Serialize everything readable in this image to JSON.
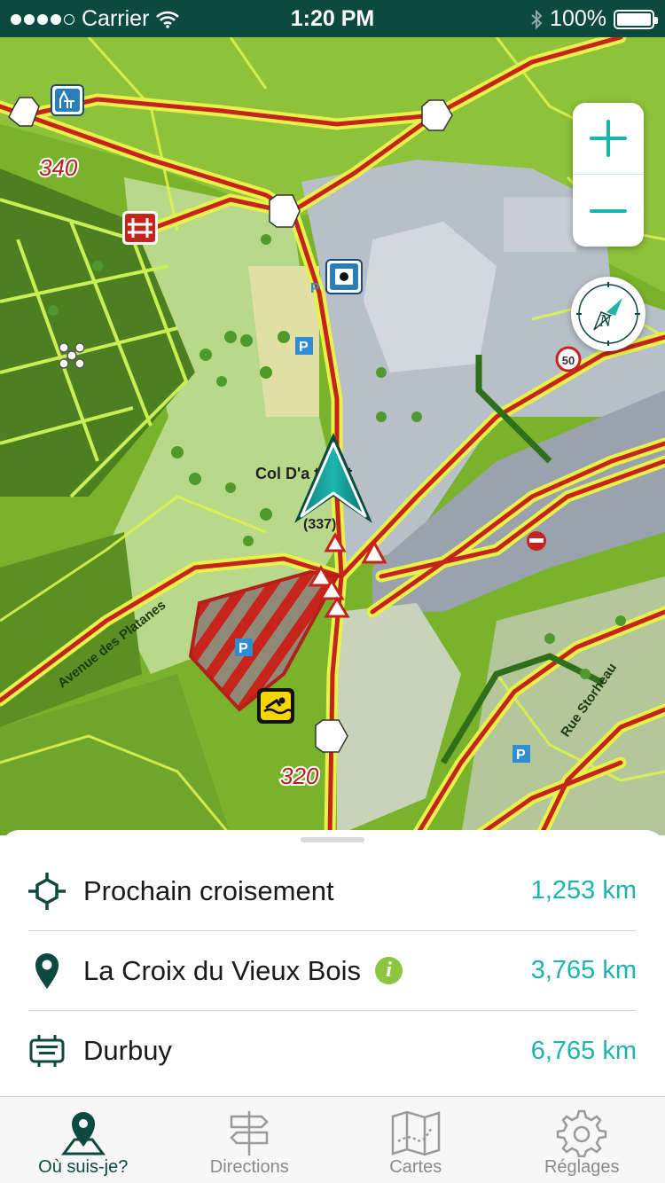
{
  "status_bar": {
    "carrier": "Carrier",
    "time": "1:20 PM",
    "battery": "100%"
  },
  "map": {
    "elevation_labels": [
      "340",
      "320"
    ],
    "place_label": "Col D'a    tte et",
    "place_elevation": "(337)",
    "street_labels": [
      "Avenue des Platanes",
      "Rue Storheau"
    ],
    "speed_limit": "50"
  },
  "nearby": [
    {
      "icon": "crossroads-icon",
      "label": "Prochain croisement",
      "distance": "1,253 km"
    },
    {
      "icon": "location-pin-icon",
      "label": "La Croix du Vieux Bois",
      "distance": "3,765 km"
    },
    {
      "icon": "signpost-board-icon",
      "label": "Durbuy",
      "distance": "6,765 km"
    }
  ],
  "info_glyph": "i",
  "tabs": [
    {
      "label": "Où suis-je?",
      "icon": "map-pin-tab-icon",
      "active": true
    },
    {
      "label": "Directions",
      "icon": "signpost-tab-icon",
      "active": false
    },
    {
      "label": "Cartes",
      "icon": "folded-map-tab-icon",
      "active": false
    },
    {
      "label": "Réglages",
      "icon": "gear-tab-icon",
      "active": false
    }
  ],
  "colors": {
    "accent": "#1cb5ae",
    "dark": "#0c4a3f",
    "info": "#8cc63f"
  }
}
